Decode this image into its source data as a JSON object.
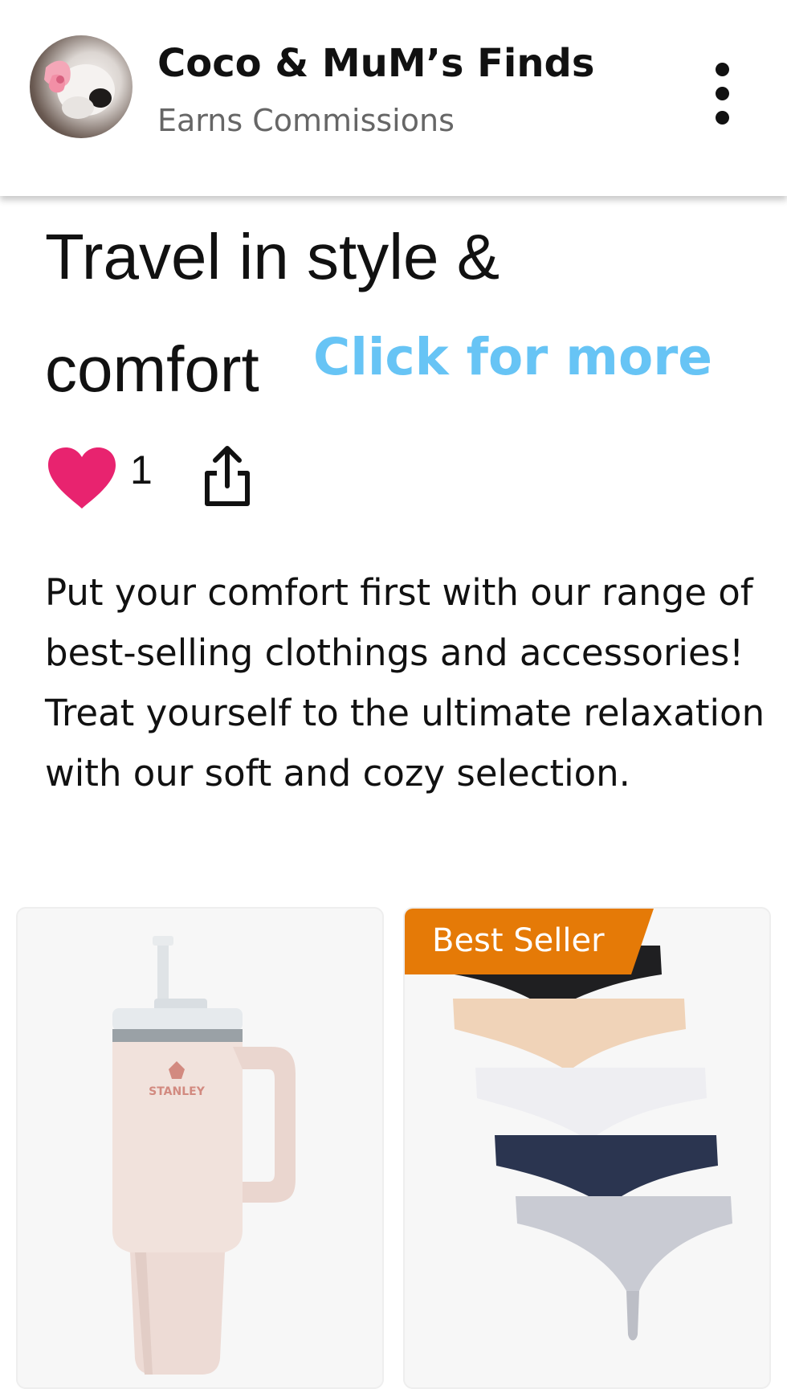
{
  "header": {
    "account_name": "Coco & MuM’s Finds",
    "account_subtitle": "Earns Commissions",
    "avatar_icon": "avatar",
    "menu_icon": "more-vertical-icon"
  },
  "post": {
    "title_line1": "Travel in style &",
    "title_line2": "comfort",
    "click_more": "Click for more",
    "like_count": "1",
    "like_icon": "heart-icon",
    "share_icon": "share-icon",
    "description": "Put your comfort first with our range of best-selling clothings and accessories! Treat yourself to the ultimate relaxation with our soft and cozy selection."
  },
  "products": [
    {
      "image": "stanley-tumbler-pink",
      "image_brand_text": "STANLEY"
    },
    {
      "image": "underwear-5-pack",
      "badge": "Best Seller"
    }
  ],
  "colors": {
    "link": "#67c4f5",
    "heart": "#e8236f",
    "badge": "#e57a07",
    "text": "#111111",
    "subtext": "#666666"
  }
}
